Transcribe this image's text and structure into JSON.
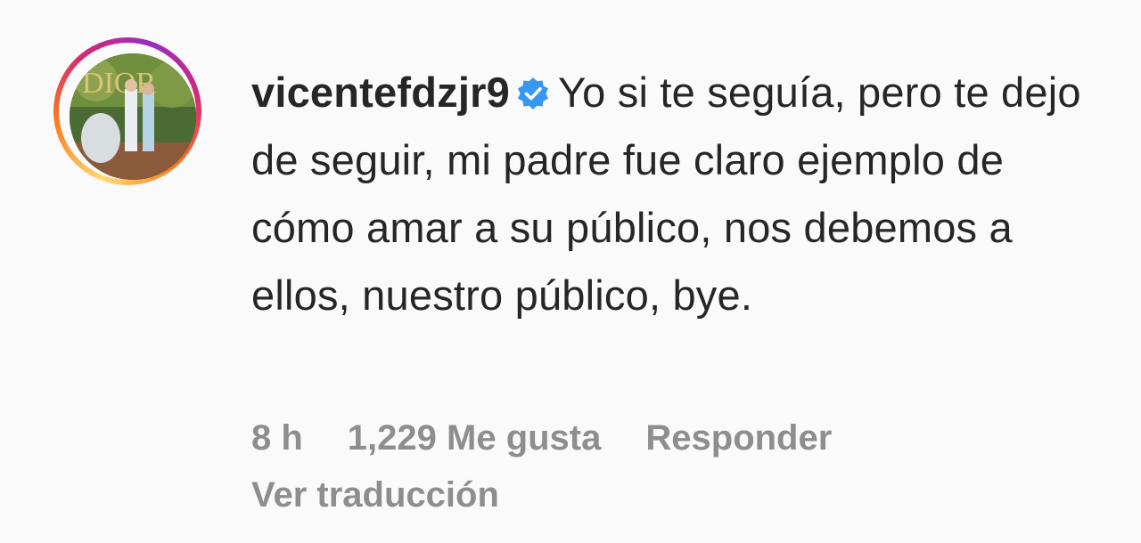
{
  "comment": {
    "username": "vicentefdzjr9",
    "verified_icon": "verified-badge-icon",
    "verified_color": "#3897f0",
    "text": "Yo si te seguía, pero te dejo de seguir, mi padre fue claro ejemplo de cómo amar a su público, nos debemos a ellos, nuestro público, bye.",
    "time": "8 h",
    "likes": "1,229 Me gusta",
    "reply_label": "Responder",
    "translate_label": "Ver traducción"
  },
  "colors": {
    "text": "#262626",
    "meta": "#8e8e8e",
    "background": "#fafafa"
  }
}
